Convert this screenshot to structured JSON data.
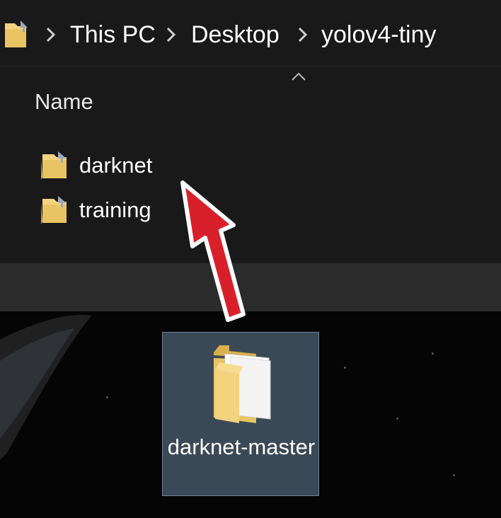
{
  "breadcrumb": {
    "items": [
      "This PC",
      "Desktop",
      "yolov4-tiny"
    ]
  },
  "list": {
    "column_header": "Name",
    "items": [
      {
        "name": "darknet",
        "icon": "folder-shortcut-icon"
      },
      {
        "name": "training",
        "icon": "folder-shortcut-icon"
      }
    ]
  },
  "desktop": {
    "icon_label": "darknet-master",
    "icon": "folder-icon"
  },
  "colors": {
    "explorer_bg": "#191919",
    "footer_band": "#2b2b2b",
    "selection_bg": "#3b4957",
    "folder_yellow": "#f3d37e",
    "arrow_red": "#d8202a"
  }
}
